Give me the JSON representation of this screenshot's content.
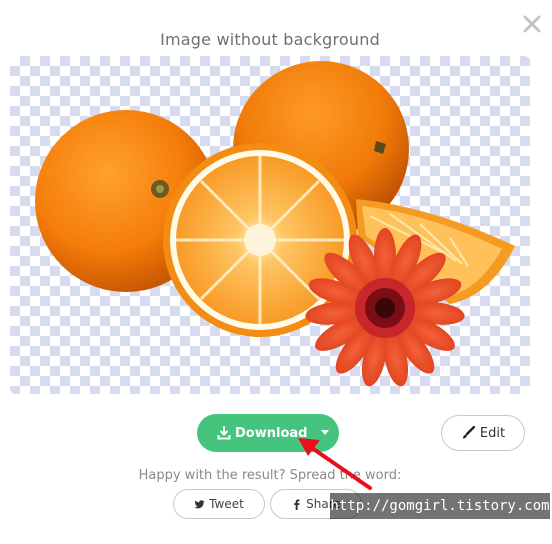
{
  "dialog": {
    "title": "Image without background",
    "close_icon": "close-icon"
  },
  "preview": {
    "content": "oranges-and-flower-cutout",
    "background": "transparency-checkerboard"
  },
  "actions": {
    "download_label": "Download",
    "download_icon": "download-icon",
    "edit_label": "Edit",
    "edit_icon": "brush-icon"
  },
  "share": {
    "prompt": "Happy with the result? Spread the word:",
    "tweet_label": "Tweet",
    "share_label": "Share"
  },
  "overlay": {
    "watermark_text": "http://gomgirl.tistory.com"
  },
  "colors": {
    "accent": "#45c47e",
    "checker": "#d7dbf0",
    "arrow": "#e8101a"
  }
}
